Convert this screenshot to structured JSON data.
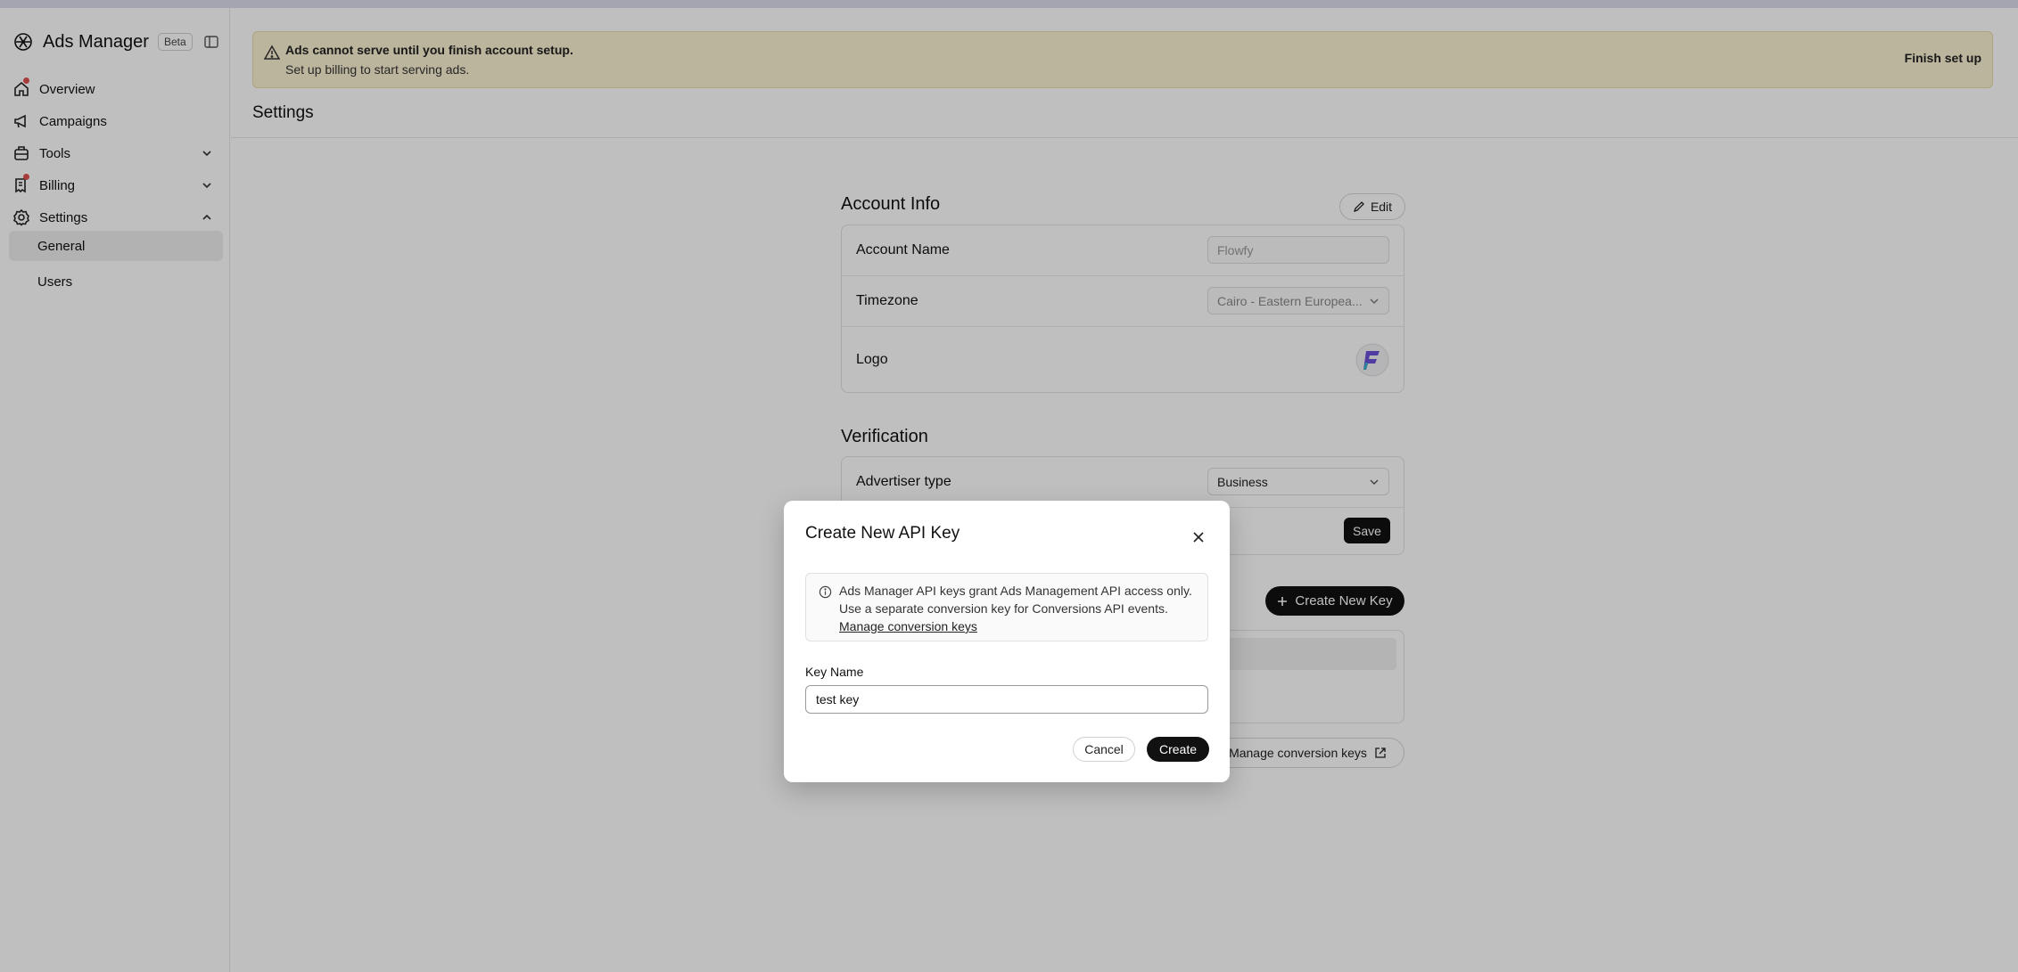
{
  "sidebar": {
    "brand": "Ads Manager",
    "badge": "Beta",
    "items": [
      {
        "label": "Overview",
        "icon": "home-icon"
      },
      {
        "label": "Campaigns",
        "icon": "megaphone-icon"
      },
      {
        "label": "Tools",
        "icon": "toolbox-icon"
      },
      {
        "label": "Billing",
        "icon": "receipt-icon"
      },
      {
        "label": "Settings",
        "icon": "gear-icon"
      }
    ],
    "sub_items": [
      "General",
      "Users"
    ]
  },
  "banner": {
    "title": "Ads cannot serve until you finish account setup.",
    "subtitle": "Set up billing to start serving ads.",
    "action": "Finish set up"
  },
  "page_title": "Settings",
  "account_info": {
    "title": "Account Info",
    "edit_label": "Edit",
    "account_name_label": "Account Name",
    "account_name_value": "Flowfy",
    "timezone_label": "Timezone",
    "timezone_value": "Cairo - Eastern Europea...",
    "logo_label": "Logo"
  },
  "verification": {
    "title": "Verification",
    "advertiser_type_label": "Advertiser type",
    "advertiser_type_value": "Business",
    "save_label": "Save"
  },
  "api_keys": {
    "create_label": "Create New Key",
    "manage_label": "Manage conversion keys"
  },
  "modal": {
    "title": "Create New API Key",
    "info_text": "Ads Manager API keys grant Ads Management API access only. Use a separate conversion key for Conversions API events.",
    "info_link": "Manage conversion keys",
    "key_name_label": "Key Name",
    "key_name_value": "test key",
    "cancel_label": "Cancel",
    "create_label": "Create"
  },
  "colors": {
    "banner_bg": "#fbf2d2",
    "primary": "#111111",
    "notification_dot": "#e05050"
  }
}
